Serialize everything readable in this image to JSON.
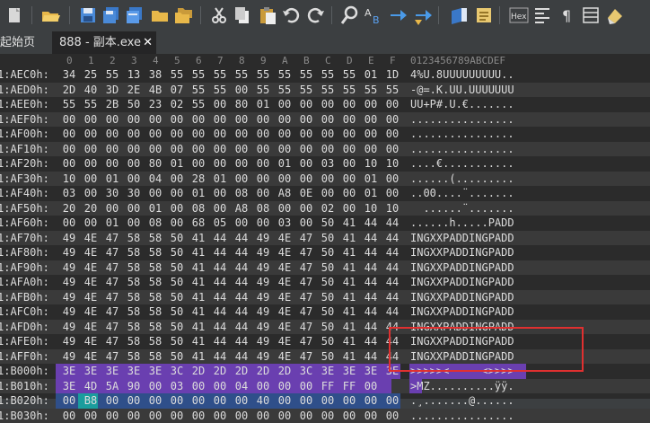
{
  "toolbar": {
    "icons": [
      "new-file",
      "open-folder",
      "save",
      "save-all",
      "save-copy",
      "open-folder-2",
      "open-folders",
      "cut",
      "copy",
      "paste",
      "undo",
      "redo",
      "find",
      "find-replace",
      "goto",
      "goto-next",
      "bookmark",
      "bookmark-list",
      "hex-mode",
      "template",
      "pilcrow",
      "columns",
      "clear"
    ],
    "hex_label": "Hex"
  },
  "tabs": [
    {
      "label": "起始页",
      "active": false
    },
    {
      "label": "888 - 副本.exe",
      "active": true,
      "close": "✕"
    }
  ],
  "editor": {
    "column_headers": [
      "0",
      "1",
      "2",
      "3",
      "4",
      "5",
      "6",
      "7",
      "8",
      "9",
      "A",
      "B",
      "C",
      "D",
      "E",
      "F"
    ],
    "ascii_header": "0123456789ABCDEF",
    "rows": [
      {
        "offset": "1:AEC0h:",
        "bytes": [
          "34",
          "25",
          "55",
          "13",
          "38",
          "55",
          "55",
          "55",
          "55",
          "55",
          "55",
          "55",
          "55",
          "55",
          "01",
          "1D"
        ],
        "ascii": "4%U.8UUUUUUUUU.."
      },
      {
        "offset": "1:AED0h:",
        "bytes": [
          "2D",
          "40",
          "3D",
          "2E",
          "4B",
          "07",
          "55",
          "55",
          "00",
          "55",
          "55",
          "55",
          "55",
          "55",
          "55",
          "55"
        ],
        "ascii": "-@=.K.UU.UUUUUUU"
      },
      {
        "offset": "1:AEE0h:",
        "bytes": [
          "55",
          "55",
          "2B",
          "50",
          "23",
          "02",
          "55",
          "00",
          "80",
          "01",
          "00",
          "00",
          "00",
          "00",
          "00",
          "00"
        ],
        "ascii": "UU+P#.U.€......."
      },
      {
        "offset": "1:AEF0h:",
        "bytes": [
          "00",
          "00",
          "00",
          "00",
          "00",
          "00",
          "00",
          "00",
          "00",
          "00",
          "00",
          "00",
          "00",
          "00",
          "00",
          "00"
        ],
        "ascii": "................"
      },
      {
        "offset": "1:AF00h:",
        "bytes": [
          "00",
          "00",
          "00",
          "00",
          "00",
          "00",
          "00",
          "00",
          "00",
          "00",
          "00",
          "00",
          "00",
          "00",
          "00",
          "00"
        ],
        "ascii": "................"
      },
      {
        "offset": "1:AF10h:",
        "bytes": [
          "00",
          "00",
          "00",
          "00",
          "00",
          "00",
          "00",
          "00",
          "00",
          "00",
          "00",
          "00",
          "00",
          "00",
          "00",
          "00"
        ],
        "ascii": "................"
      },
      {
        "offset": "1:AF20h:",
        "bytes": [
          "00",
          "00",
          "00",
          "00",
          "80",
          "01",
          "00",
          "00",
          "00",
          "00",
          "01",
          "00",
          "03",
          "00",
          "10",
          "10"
        ],
        "ascii": "....€..........."
      },
      {
        "offset": "1:AF30h:",
        "bytes": [
          "10",
          "00",
          "01",
          "00",
          "04",
          "00",
          "28",
          "01",
          "00",
          "00",
          "00",
          "00",
          "00",
          "00",
          "01",
          "00"
        ],
        "ascii": "......(........."
      },
      {
        "offset": "1:AF40h:",
        "bytes": [
          "03",
          "00",
          "30",
          "30",
          "00",
          "00",
          "01",
          "00",
          "08",
          "00",
          "A8",
          "0E",
          "00",
          "00",
          "01",
          "00"
        ],
        "ascii": "..00....¨......."
      },
      {
        "offset": "1:AF50h:",
        "bytes": [
          "20",
          "20",
          "00",
          "00",
          "01",
          "00",
          "08",
          "00",
          "A8",
          "08",
          "00",
          "00",
          "02",
          "00",
          "10",
          "10"
        ],
        "ascii": "  ......¨......."
      },
      {
        "offset": "1:AF60h:",
        "bytes": [
          "00",
          "00",
          "01",
          "00",
          "08",
          "00",
          "68",
          "05",
          "00",
          "00",
          "03",
          "00",
          "50",
          "41",
          "44",
          "44"
        ],
        "ascii": "......h.....PADD"
      },
      {
        "offset": "1:AF70h:",
        "bytes": [
          "49",
          "4E",
          "47",
          "58",
          "58",
          "50",
          "41",
          "44",
          "44",
          "49",
          "4E",
          "47",
          "50",
          "41",
          "44",
          "44"
        ],
        "ascii": "INGXXPADDINGPADD"
      },
      {
        "offset": "1:AF80h:",
        "bytes": [
          "49",
          "4E",
          "47",
          "58",
          "58",
          "50",
          "41",
          "44",
          "44",
          "49",
          "4E",
          "47",
          "50",
          "41",
          "44",
          "44"
        ],
        "ascii": "INGXXPADDINGPADD"
      },
      {
        "offset": "1:AF90h:",
        "bytes": [
          "49",
          "4E",
          "47",
          "58",
          "58",
          "50",
          "41",
          "44",
          "44",
          "49",
          "4E",
          "47",
          "50",
          "41",
          "44",
          "44"
        ],
        "ascii": "INGXXPADDINGPADD"
      },
      {
        "offset": "1:AFA0h:",
        "bytes": [
          "49",
          "4E",
          "47",
          "58",
          "58",
          "50",
          "41",
          "44",
          "44",
          "49",
          "4E",
          "47",
          "50",
          "41",
          "44",
          "44"
        ],
        "ascii": "INGXXPADDINGPADD"
      },
      {
        "offset": "1:AFB0h:",
        "bytes": [
          "49",
          "4E",
          "47",
          "58",
          "58",
          "50",
          "41",
          "44",
          "44",
          "49",
          "4E",
          "47",
          "50",
          "41",
          "44",
          "44"
        ],
        "ascii": "INGXXPADDINGPADD"
      },
      {
        "offset": "1:AFC0h:",
        "bytes": [
          "49",
          "4E",
          "47",
          "58",
          "58",
          "50",
          "41",
          "44",
          "44",
          "49",
          "4E",
          "47",
          "50",
          "41",
          "44",
          "44"
        ],
        "ascii": "INGXXPADDINGPADD"
      },
      {
        "offset": "1:AFD0h:",
        "bytes": [
          "49",
          "4E",
          "47",
          "58",
          "58",
          "50",
          "41",
          "44",
          "44",
          "49",
          "4E",
          "47",
          "50",
          "41",
          "44",
          "44"
        ],
        "ascii": "INGXXPADDINGPADD"
      },
      {
        "offset": "1:AFE0h:",
        "bytes": [
          "49",
          "4E",
          "47",
          "58",
          "58",
          "50",
          "41",
          "44",
          "44",
          "49",
          "4E",
          "47",
          "50",
          "41",
          "44",
          "44"
        ],
        "ascii": "INGXXPADDINGPADD"
      },
      {
        "offset": "1:AFF0h:",
        "bytes": [
          "49",
          "4E",
          "47",
          "58",
          "58",
          "50",
          "41",
          "44",
          "44",
          "49",
          "4E",
          "47",
          "50",
          "41",
          "44",
          "44"
        ],
        "ascii": "INGXXPADDINGPADD"
      },
      {
        "offset": "1:B000h:",
        "bytes": [
          "3E",
          "3E",
          "3E",
          "3E",
          "3E",
          "3C",
          "2D",
          "2D",
          "2D",
          "2D",
          "2D",
          "3C",
          "3E",
          "3E",
          "3E",
          "3E"
        ],
        "ascii": ">>>>><-----<>>>>"
      },
      {
        "offset": "1:B010h:",
        "bytes": [
          "3E",
          "4D",
          "5A",
          "90",
          "00",
          "03",
          "00",
          "00",
          "04",
          "00",
          "00",
          "00",
          "FF",
          "FF",
          "00",
          ""
        ],
        "ascii": ">MZ..........ÿÿ."
      },
      {
        "offset": "1:B020h:",
        "bytes": [
          "00",
          "B8",
          "00",
          "00",
          "00",
          "00",
          "00",
          "00",
          "00",
          "40",
          "00",
          "00",
          "00",
          "00",
          "00",
          "00"
        ],
        "ascii": ".¸.......@......"
      },
      {
        "offset": "1:B030h:",
        "bytes": [
          "00",
          "00",
          "00",
          "00",
          "00",
          "00",
          "00",
          "00",
          "00",
          "00",
          "00",
          "00",
          "00",
          "00",
          "00",
          "00"
        ],
        "ascii": "................"
      }
    ]
  },
  "colors": {
    "selection": "#6a3fb0",
    "selection_secondary": "#2f4f8a",
    "cursor": "#1a9d9d",
    "highlight_box": "#e03030"
  }
}
